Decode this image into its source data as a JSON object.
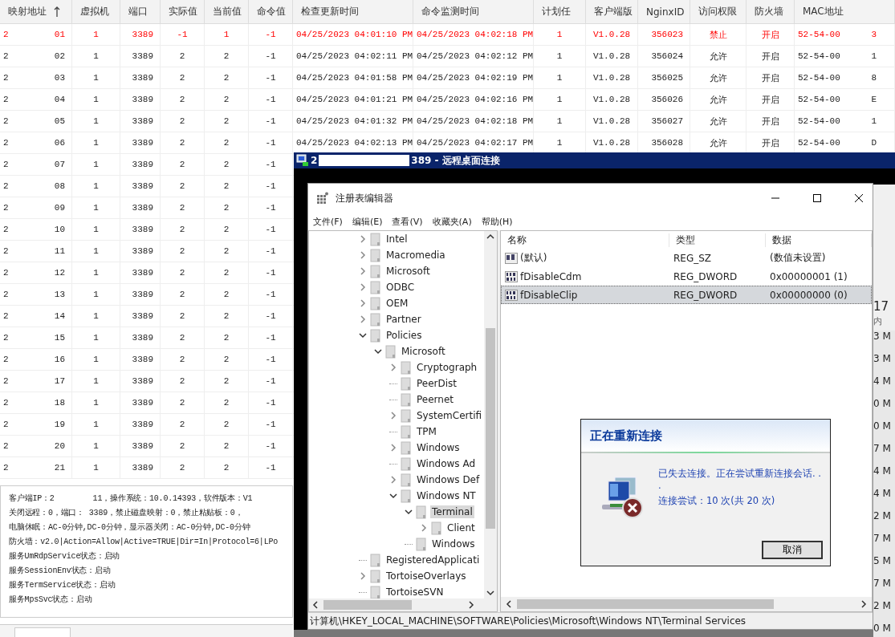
{
  "table": {
    "columns": [
      {
        "label": "映射地址",
        "sorted": true
      },
      {
        "label": "虚拟机",
        "sorted": false
      },
      {
        "label": "端口",
        "sorted": false
      },
      {
        "label": "实际值",
        "sorted": false
      },
      {
        "label": "当前值",
        "sorted": false
      },
      {
        "label": "命令值",
        "sorted": false
      },
      {
        "label": "检查更新时间",
        "sorted": false
      },
      {
        "label": "命令监测时间",
        "sorted": false
      },
      {
        "label": "计划任",
        "sorted": false
      },
      {
        "label": "客户端版",
        "sorted": false
      },
      {
        "label": "NginxID",
        "sorted": false
      },
      {
        "label": "访问权限",
        "sorted": false
      },
      {
        "label": "防火墙",
        "sorted": false
      },
      {
        "label": "MAC地址",
        "sorted": false
      }
    ],
    "rows": [
      {
        "alert": true,
        "cells": [
          "2",
          "1",
          "3389",
          "-1",
          "1",
          "-1",
          "04/25/2023 04:01:10 PM",
          "04/25/2023 04:02:18 PM",
          "1",
          "V1.0.28",
          "356023",
          "禁止",
          "开启",
          "52-54-00"
        ],
        "address_suffix": "01",
        "mac_suffix": "3"
      },
      {
        "alert": false,
        "cells": [
          "2",
          "1",
          "3389",
          "2",
          "2",
          "-1",
          "04/25/2023 04:02:11 PM",
          "04/25/2023 04:02:12 PM",
          "1",
          "V1.0.28",
          "356024",
          "允许",
          "开启",
          "52-54-00"
        ],
        "address_suffix": "02",
        "mac_suffix": "1"
      },
      {
        "alert": false,
        "cells": [
          "2",
          "1",
          "3389",
          "2",
          "2",
          "-1",
          "04/25/2023 04:01:58 PM",
          "04/25/2023 04:02:19 PM",
          "1",
          "V1.0.28",
          "356025",
          "允许",
          "开启",
          "52-54-00"
        ],
        "address_suffix": "03",
        "mac_suffix": "8"
      },
      {
        "alert": false,
        "cells": [
          "2",
          "1",
          "3389",
          "2",
          "2",
          "-1",
          "04/25/2023 04:01:21 PM",
          "04/25/2023 04:02:16 PM",
          "1",
          "V1.0.28",
          "356026",
          "允许",
          "开启",
          "52-54-00"
        ],
        "address_suffix": "04",
        "mac_suffix": "E"
      },
      {
        "alert": false,
        "cells": [
          "2",
          "1",
          "3389",
          "2",
          "2",
          "-1",
          "04/25/2023 04:01:32 PM",
          "04/25/2023 04:02:18 PM",
          "1",
          "V1.0.28",
          "356027",
          "允许",
          "开启",
          "52-54-00"
        ],
        "address_suffix": "05",
        "mac_suffix": "1"
      },
      {
        "alert": false,
        "cells": [
          "2",
          "1",
          "3389",
          "2",
          "2",
          "-1",
          "04/25/2023 04:02:13 PM",
          "04/25/2023 04:02:17 PM",
          "1",
          "V1.0.28",
          "356028",
          "允许",
          "开启",
          "52-54-00"
        ],
        "address_suffix": "06",
        "mac_suffix": "D"
      },
      {
        "alert": false,
        "cells": [
          "2",
          "1",
          "3389",
          "2",
          "2",
          "-1"
        ],
        "address_suffix": "07"
      },
      {
        "alert": false,
        "cells": [
          "2",
          "1",
          "3389",
          "2",
          "2",
          "-1"
        ],
        "address_suffix": "08"
      },
      {
        "alert": false,
        "cells": [
          "2",
          "1",
          "3389",
          "2",
          "2",
          "-1"
        ],
        "address_suffix": "09"
      },
      {
        "alert": false,
        "cells": [
          "2",
          "1",
          "3389",
          "2",
          "2",
          "-1"
        ],
        "address_suffix": "10"
      },
      {
        "alert": false,
        "cells": [
          "2",
          "1",
          "3389",
          "2",
          "2",
          "-1"
        ],
        "address_suffix": "11"
      },
      {
        "alert": false,
        "cells": [
          "2",
          "1",
          "3389",
          "2",
          "2",
          "-1"
        ],
        "address_suffix": "12"
      },
      {
        "alert": false,
        "cells": [
          "2",
          "1",
          "3389",
          "2",
          "2",
          "-1"
        ],
        "address_suffix": "13"
      },
      {
        "alert": false,
        "cells": [
          "2",
          "1",
          "3389",
          "2",
          "2",
          "-1"
        ],
        "address_suffix": "14"
      },
      {
        "alert": false,
        "cells": [
          "2",
          "1",
          "3389",
          "2",
          "2",
          "-1"
        ],
        "address_suffix": "15"
      },
      {
        "alert": false,
        "cells": [
          "2",
          "1",
          "3389",
          "2",
          "2",
          "-1"
        ],
        "address_suffix": "16"
      },
      {
        "alert": false,
        "cells": [
          "2",
          "1",
          "3389",
          "2",
          "2",
          "-1"
        ],
        "address_suffix": "17"
      },
      {
        "alert": false,
        "cells": [
          "2",
          "1",
          "3389",
          "2",
          "2",
          "-1"
        ],
        "address_suffix": "18"
      },
      {
        "alert": false,
        "cells": [
          "2",
          "1",
          "3389",
          "2",
          "2",
          "-1"
        ],
        "address_suffix": "19"
      },
      {
        "alert": false,
        "cells": [
          "2",
          "1",
          "3389",
          "2",
          "2",
          "-1"
        ],
        "address_suffix": "20"
      },
      {
        "alert": false,
        "cells": [
          "2",
          "1",
          "3389",
          "2",
          "2",
          "-1"
        ],
        "address_suffix": "21"
      }
    ]
  },
  "info_panel": {
    "lines": [
      [
        "客户端IP：2",
        "11，操作系统：10.0.14393，软件版本：V1"
      ],
      [
        "关闭远程：0，端口： 3389，禁止磁盘映射：0，禁止粘贴板：0，"
      ],
      [
        "电脑休眠：AC-0分钟,DC-0分钟，显示器关闭：AC-0分钟,DC-0分钟"
      ],
      [
        "防火墙：v2.0|Action=Allow|Active=TRUE|Dir=In|Protocol=6|LPo"
      ],
      [
        "服务UmRdpService状态：启动"
      ],
      [
        "服务SessionEnv状态：启动"
      ],
      [
        "服务TermService状态：启动"
      ],
      [
        "服务MpsSvc状态：启动"
      ]
    ]
  },
  "remote_desktop": {
    "title_parts": [
      "2",
      "389 - 远程桌面连接"
    ],
    "background_window": {
      "cpu": "17",
      "header": "内",
      "values": [
        "3 M",
        "3 M",
        "4 M",
        "0 M",
        "0 M",
        "7 M",
        "4 M",
        "4 M",
        "2 M",
        "7 M",
        "5 M",
        "7 M",
        "2 M",
        "0 M"
      ]
    },
    "registry": {
      "title": "注册表编辑器",
      "menu": [
        "文件(F)",
        "编辑(E)",
        "查看(V)",
        "收藏夹(A)",
        "帮助(H)"
      ],
      "tree": [
        {
          "label": "Intel",
          "expandable": true,
          "selected": false
        },
        {
          "label": "Macromedia",
          "expandable": true,
          "selected": false
        },
        {
          "label": "Microsoft",
          "expandable": true,
          "selected": false
        },
        {
          "label": "ODBC",
          "expandable": true,
          "selected": false
        },
        {
          "label": "OEM",
          "expandable": true,
          "selected": false
        },
        {
          "label": "Partner",
          "expandable": true,
          "selected": false
        },
        {
          "label": "Policies",
          "selected": false,
          "children": [
            {
              "label": "Microsoft",
              "selected": false,
              "children": [
                {
                  "label": "Cryptograph",
                  "expandable": true,
                  "selected": false
                },
                {
                  "label": "PeerDist",
                  "expandable": false,
                  "selected": false
                },
                {
                  "label": "Peernet",
                  "expandable": false,
                  "selected": false
                },
                {
                  "label": "SystemCertifi",
                  "expandable": true,
                  "selected": false
                },
                {
                  "label": "TPM",
                  "expandable": false,
                  "selected": false
                },
                {
                  "label": "Windows",
                  "expandable": true,
                  "selected": false
                },
                {
                  "label": "Windows Ad",
                  "expandable": false,
                  "selected": false
                },
                {
                  "label": "Windows Def",
                  "expandable": true,
                  "selected": false
                },
                {
                  "label": "Windows NT",
                  "selected": false,
                  "children": [
                    {
                      "label": "Terminal",
                      "selected": true,
                      "children": [
                        {
                          "label": "Client",
                          "expandable": true,
                          "selected": false
                        }
                      ]
                    },
                    {
                      "label": "Windows",
                      "expandable": false,
                      "selected": false
                    }
                  ]
                }
              ]
            }
          ]
        },
        {
          "label": "RegisteredApplicati",
          "expandable": false,
          "selected": false
        },
        {
          "label": "TortoiseOverlays",
          "expandable": true,
          "selected": false
        },
        {
          "label": "TortoiseSVN",
          "expandable": false,
          "selected": false
        }
      ],
      "columns": [
        "名称",
        "类型",
        "数据"
      ],
      "values": [
        {
          "kind": "string",
          "name": "(默认)",
          "type": "REG_SZ",
          "data": "(数值未设置)",
          "selected": false
        },
        {
          "kind": "dword",
          "name": "fDisableCdm",
          "type": "REG_DWORD",
          "data": "0x00000001 (1)",
          "selected": false
        },
        {
          "kind": "dword",
          "name": "fDisableClip",
          "type": "REG_DWORD",
          "data": "0x00000000 (0)",
          "selected": true
        }
      ],
      "status": "计算机\\HKEY_LOCAL_MACHINE\\SOFTWARE\\Policies\\Microsoft\\Windows NT\\Terminal Services"
    },
    "dialog": {
      "title": "正在重新连接",
      "message": "已失去连接。正在尝试重新连接会话. . .",
      "attempts": "连接尝试：10 次(共 20 次)",
      "button": "取消"
    }
  }
}
